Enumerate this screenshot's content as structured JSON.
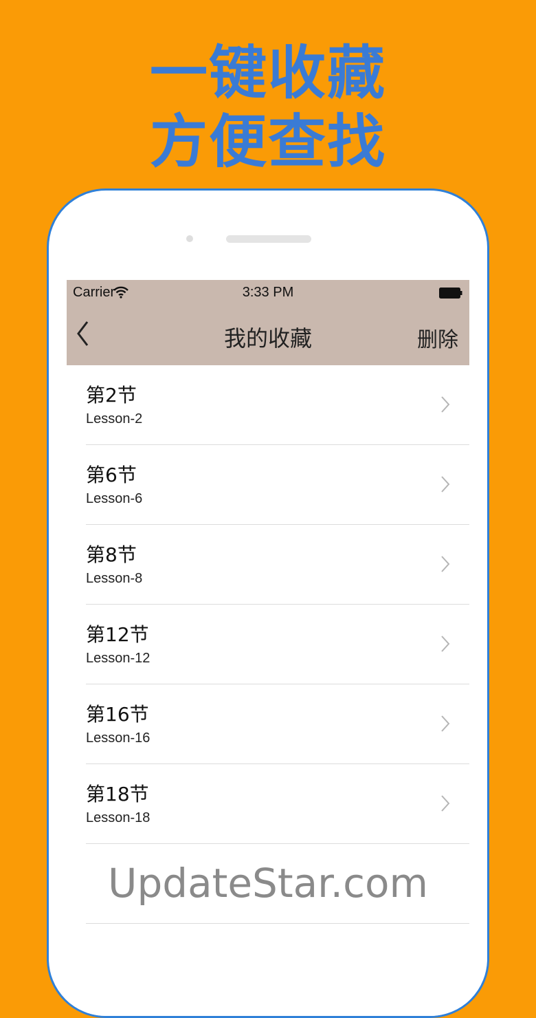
{
  "promo": {
    "line1": "一键收藏",
    "line2": "方便查找"
  },
  "status_bar": {
    "carrier": "Carrier",
    "time": "3:33 PM"
  },
  "nav": {
    "title": "我的收藏",
    "delete_label": "删除"
  },
  "favorites": [
    {
      "title": "第2节",
      "subtitle": "Lesson-2"
    },
    {
      "title": "第6节",
      "subtitle": "Lesson-6"
    },
    {
      "title": "第8节",
      "subtitle": "Lesson-8"
    },
    {
      "title": "第12节",
      "subtitle": "Lesson-12"
    },
    {
      "title": "第16节",
      "subtitle": "Lesson-16"
    },
    {
      "title": "第18节",
      "subtitle": "Lesson-18"
    }
  ],
  "watermark": "UpdateStar.com",
  "colors": {
    "background": "#FA9B06",
    "headline": "#3A7BD5",
    "phone_border": "#2F80D8",
    "nav_bar": "#C9B8AE"
  }
}
